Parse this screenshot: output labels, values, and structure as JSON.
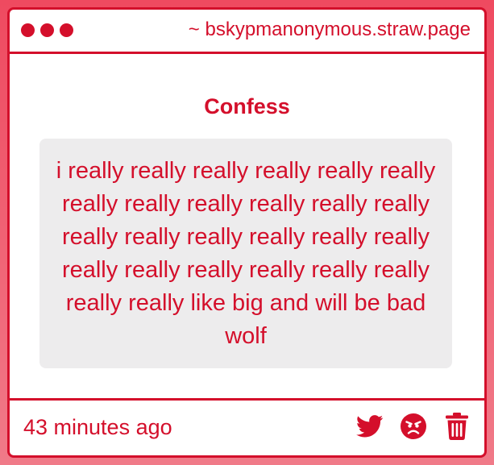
{
  "window": {
    "url": "~ bskypmanonymous.straw.page"
  },
  "post": {
    "heading": "Confess",
    "message": "i really really really really really really really really really really really really really really really really really really really really really really really really really really like big and will be bad wolf",
    "timestamp": "43 minutes ago"
  },
  "actions": [
    {
      "name": "share-twitter",
      "icon": "twitter-icon"
    },
    {
      "name": "react-angry",
      "icon": "angry-face-icon"
    },
    {
      "name": "delete",
      "icon": "trash-icon"
    }
  ],
  "colors": {
    "accent": "#d40f2b",
    "box_background": "#edeced",
    "page_background": "#ef4a60"
  }
}
